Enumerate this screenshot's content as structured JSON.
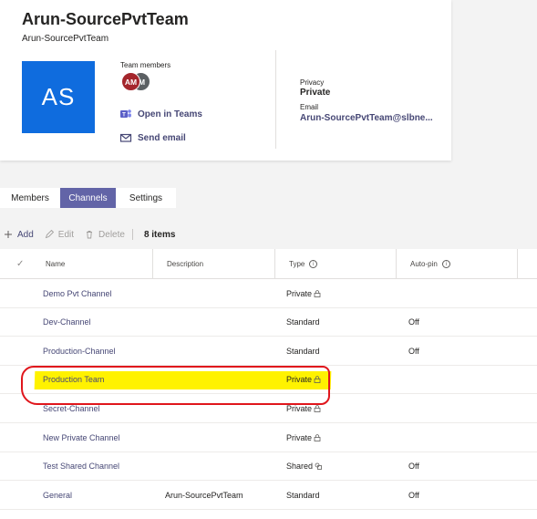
{
  "header": {
    "team_name": "Arun-SourcePvtTeam",
    "team_subtitle": "Arun-SourcePvtTeam",
    "avatar_initials": "AS",
    "avatar_color": "#0f6cde",
    "members_label": "Team members",
    "member_avatars": [
      {
        "initials": "AM",
        "color": "#a4262c"
      },
      {
        "initials": "M",
        "color": "#5b6063"
      }
    ],
    "open_in_teams": "Open in Teams",
    "send_email": "Send email",
    "privacy_label": "Privacy",
    "privacy_value": "Private",
    "email_label": "Email",
    "email_value": "Arun-SourcePvtTeam@slbne..."
  },
  "tabs": [
    {
      "label": "Members",
      "active": false
    },
    {
      "label": "Channels",
      "active": true
    },
    {
      "label": "Settings",
      "active": false
    }
  ],
  "toolbar": {
    "add": "Add",
    "edit": "Edit",
    "delete": "Delete",
    "count": "8 items"
  },
  "table": {
    "columns": {
      "check": "✓",
      "name": "Name",
      "description": "Description",
      "type": "Type",
      "auto_pin": "Auto-pin"
    },
    "rows": [
      {
        "name": "Demo Pvt Channel",
        "description": "",
        "type": "Private",
        "type_icon": "lock-icon",
        "auto_pin": ""
      },
      {
        "name": "Dev-Channel",
        "description": "",
        "type": "Standard",
        "type_icon": "",
        "auto_pin": "Off"
      },
      {
        "name": "Production-Channel",
        "description": "",
        "type": "Standard",
        "type_icon": "",
        "auto_pin": "Off"
      },
      {
        "name": "Production Team",
        "description": "",
        "type": "Private",
        "type_icon": "lock-icon",
        "auto_pin": "",
        "highlighted": true
      },
      {
        "name": "Secret-Channel",
        "description": "",
        "type": "Private",
        "type_icon": "lock-icon",
        "auto_pin": ""
      },
      {
        "name": "New Private Channel",
        "description": "",
        "type": "Private",
        "type_icon": "lock-icon",
        "auto_pin": ""
      },
      {
        "name": "Test Shared Channel",
        "description": "",
        "type": "Shared",
        "type_icon": "shared-icon",
        "auto_pin": "Off"
      },
      {
        "name": "General",
        "description": "Arun-SourcePvtTeam",
        "type": "Standard",
        "type_icon": "",
        "auto_pin": "Off"
      }
    ]
  },
  "colors": {
    "accent": "#6264a7",
    "link": "#464775",
    "highlight": "#fff200",
    "annotation": "#e0161c"
  }
}
